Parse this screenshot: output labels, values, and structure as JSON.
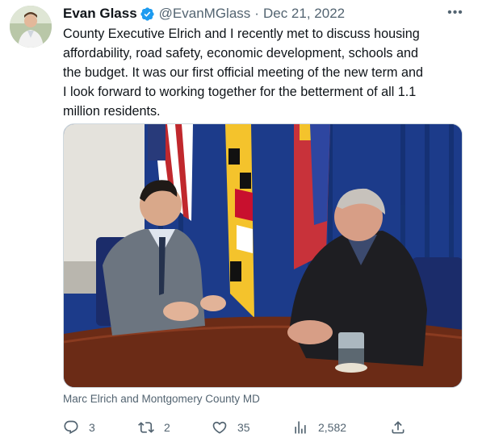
{
  "author": {
    "name": "Evan Glass",
    "handle": "@EvanMGlass",
    "separator": "·",
    "date": "Dec 21, 2022",
    "verified_icon": "verified-badge-icon",
    "more_label": "•••"
  },
  "tweet": {
    "text": "County Executive Elrich and I recently met to discuss housing\naffordability, road safety, economic development, schools and\nthe budget. It was our first official meeting of the new term and\nI look forward to working together for the betterment of all 1.1\nmillion residents."
  },
  "media": {
    "caption": "Marc Elrich and Montgomery County MD"
  },
  "actions": {
    "replies": "3",
    "retweets": "2",
    "likes": "35",
    "views": "2,582"
  },
  "colors": {
    "text_primary": "#0f1419",
    "text_secondary": "#536471",
    "verified_blue": "#1d9bf0",
    "curtain_blue": "#1c3b8a"
  }
}
